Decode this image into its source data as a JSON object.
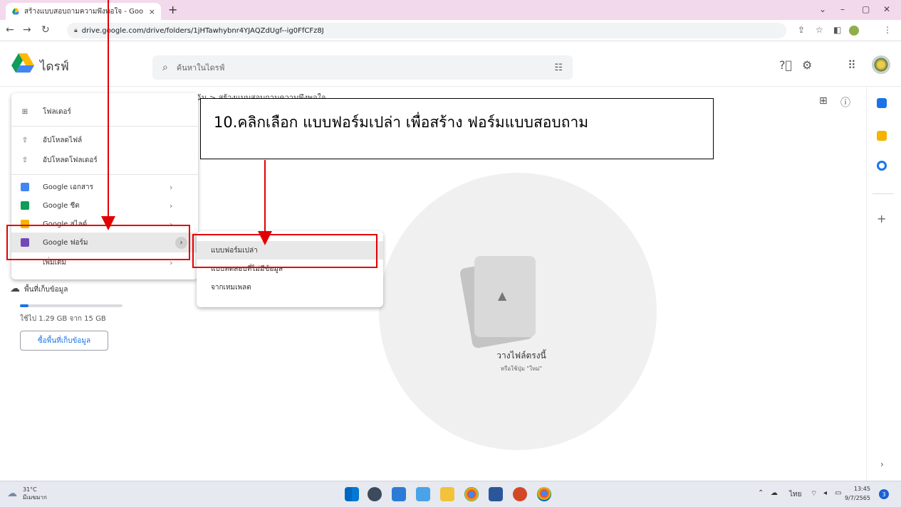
{
  "browser": {
    "tab_title": "สร้างแบบสอบถามความพึงพอใจ - Goo",
    "tab_close": "×",
    "new_tab": "+",
    "url": "drive.google.com/drive/folders/1jHTawhybnr4YJAQZdUgf--ig0FfCFz8J"
  },
  "drive": {
    "logo_text": "ไดรฟ์",
    "search_placeholder": "ค้นหาในไดรฟ์"
  },
  "breadcrumb": {
    "text": "งฉัน  >  สร้างแบบสอบถามความพึงพอใจ"
  },
  "new_menu": {
    "folder": "โฟลเดอร์",
    "upload_file": "อัปโหลดไฟล์",
    "upload_folder": "อัปโหลดโฟลเดอร์",
    "docs": "Google เอกสาร",
    "sheets": "Google ชีต",
    "slides": "Google สไลด์",
    "forms": "Google ฟอร์ม",
    "more": "เพิ่มเติม"
  },
  "forms_submenu": {
    "blank": "แบบฟอร์มเปล่า",
    "quiz": "แบบทดสอบที่ไม่มีข้อมูล",
    "template": "จากเทมเพลต"
  },
  "storage": {
    "label": "พื้นที่เก็บข้อมูล",
    "used_text": "ใช้ไป 1.29 GB จาก 15 GB",
    "used_fraction": 0.086,
    "buy_button": "ซื้อพื้นที่เก็บข้อมูล"
  },
  "dropzone": {
    "title": "วางไฟล์ตรงนี้",
    "subtitle": "หรือใช้ปุ่ม \"ใหม่\""
  },
  "annotation": {
    "text": "10.คลิกเลือก แบบฟอร์มเปล่า เพื่อสร้าง ฟอร์มแบบสอบถาม"
  },
  "taskbar": {
    "temperature": "31°C",
    "weather": "มีเมฆมาก",
    "language": "ไทย",
    "time": "13:45",
    "date": "9/7/2565",
    "notification_count": "3"
  },
  "colors": {
    "annotation_red": "#e30000",
    "drive_blue": "#1a73e8",
    "tab_strip": "#f3d9ec",
    "forms_purple": "#7248b9",
    "sheets_green": "#0f9d58",
    "docs_blue": "#4285f4",
    "slides_yellow": "#f4b400"
  }
}
